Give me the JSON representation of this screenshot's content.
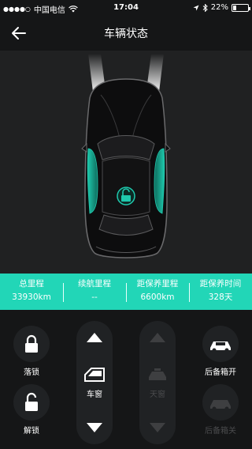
{
  "status_bar": {
    "signal": "●●●●○",
    "carrier": "中国电信",
    "time": "17:04",
    "battery": "22%",
    "battery_level": 0.22
  },
  "nav": {
    "title": "车辆状态"
  },
  "car": {
    "lock_state": "unlocked",
    "door_highlight_color": "#1fc9ad"
  },
  "stats": [
    {
      "label": "总里程",
      "value": "33930km"
    },
    {
      "label": "续航里程",
      "value": "--"
    },
    {
      "label": "距保养里程",
      "value": "6600km"
    },
    {
      "label": "距保养时间",
      "value": "328天"
    }
  ],
  "controls": {
    "lock_label": "落锁",
    "unlock_label": "解锁",
    "window_label": "车窗",
    "sunroof_label": "天窗",
    "trunk_open_label": "后备箱开",
    "trunk_close_label": "后备箱关"
  },
  "colors": {
    "accent": "#22d6b7",
    "background": "#151617",
    "panel": "#202122"
  }
}
